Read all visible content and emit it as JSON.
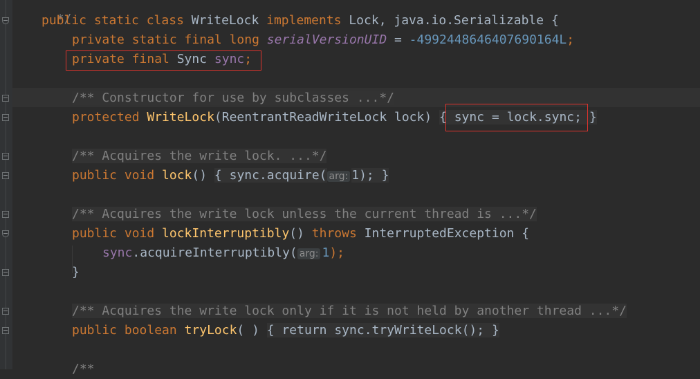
{
  "code": {
    "top_comment_tail": "*/",
    "line_class_decl": {
      "kw1": "public static class ",
      "name": "WriteLock",
      "kw2": " implements ",
      "rest": "Lock, java.io.Serializable {"
    },
    "line_serial": {
      "kw": "private static final long ",
      "field": "serialVersionUID",
      "eq": " = ",
      "num": "-4992448646407690164L",
      "semi": ";"
    },
    "line_sync_field": {
      "kw": "private final ",
      "type": "Sync ",
      "field": "sync",
      "semi": ";"
    },
    "comment_constructor": "/** Constructor for use by subclasses ...*/",
    "line_constructor": {
      "kw": "protected ",
      "name": "WriteLock",
      "params": "(ReentrantReadWriteLock lock) ",
      "brace_open": "{",
      "body_field": "sync",
      "body_eq": " = lock.",
      "body_field2": "sync",
      "body_semi": ";",
      "brace_close": "}"
    },
    "comment_lock": "/** Acquires the write lock. ...*/",
    "line_lock": {
      "kw": "public void ",
      "name": "lock",
      "parens": "() ",
      "brace_open": "{",
      "field": "sync",
      "call": ".acquire(",
      "hint": "arg:",
      "num": "1",
      "end": ");",
      "brace_close": "}"
    },
    "comment_lock_interruptibly": "/** Acquires the write lock unless the current thread is ...*/",
    "line_lock_interruptibly": {
      "kw": "public void ",
      "name": "lockInterruptibly",
      "parens": "() ",
      "throws": "throws ",
      "rest": "InterruptedException {"
    },
    "line_acquire_interruptibly": {
      "field": "sync",
      "call": ".acquireInterruptibly(",
      "hint": "arg:",
      "num": "1",
      "end": ");"
    },
    "line_close_brace": "}",
    "comment_try_lock": "/** Acquires the write lock only if it is not held by another thread ...*/",
    "line_try_lock": {
      "kw": "public boolean ",
      "name": "tryLock",
      "parens": "( ) ",
      "brace_open": "{",
      "ret": "return ",
      "field": "sync",
      "call": ".tryWriteLock()",
      "semi": ";",
      "brace_close": "}"
    },
    "bottom_comment_start": "/**"
  },
  "colors": {
    "background": "#2b2b2b",
    "keyword": "#cc7832",
    "field": "#9876aa",
    "number": "#6897bb",
    "method": "#ffc66d",
    "comment": "#808080",
    "highlight_box": "#e0332d"
  }
}
